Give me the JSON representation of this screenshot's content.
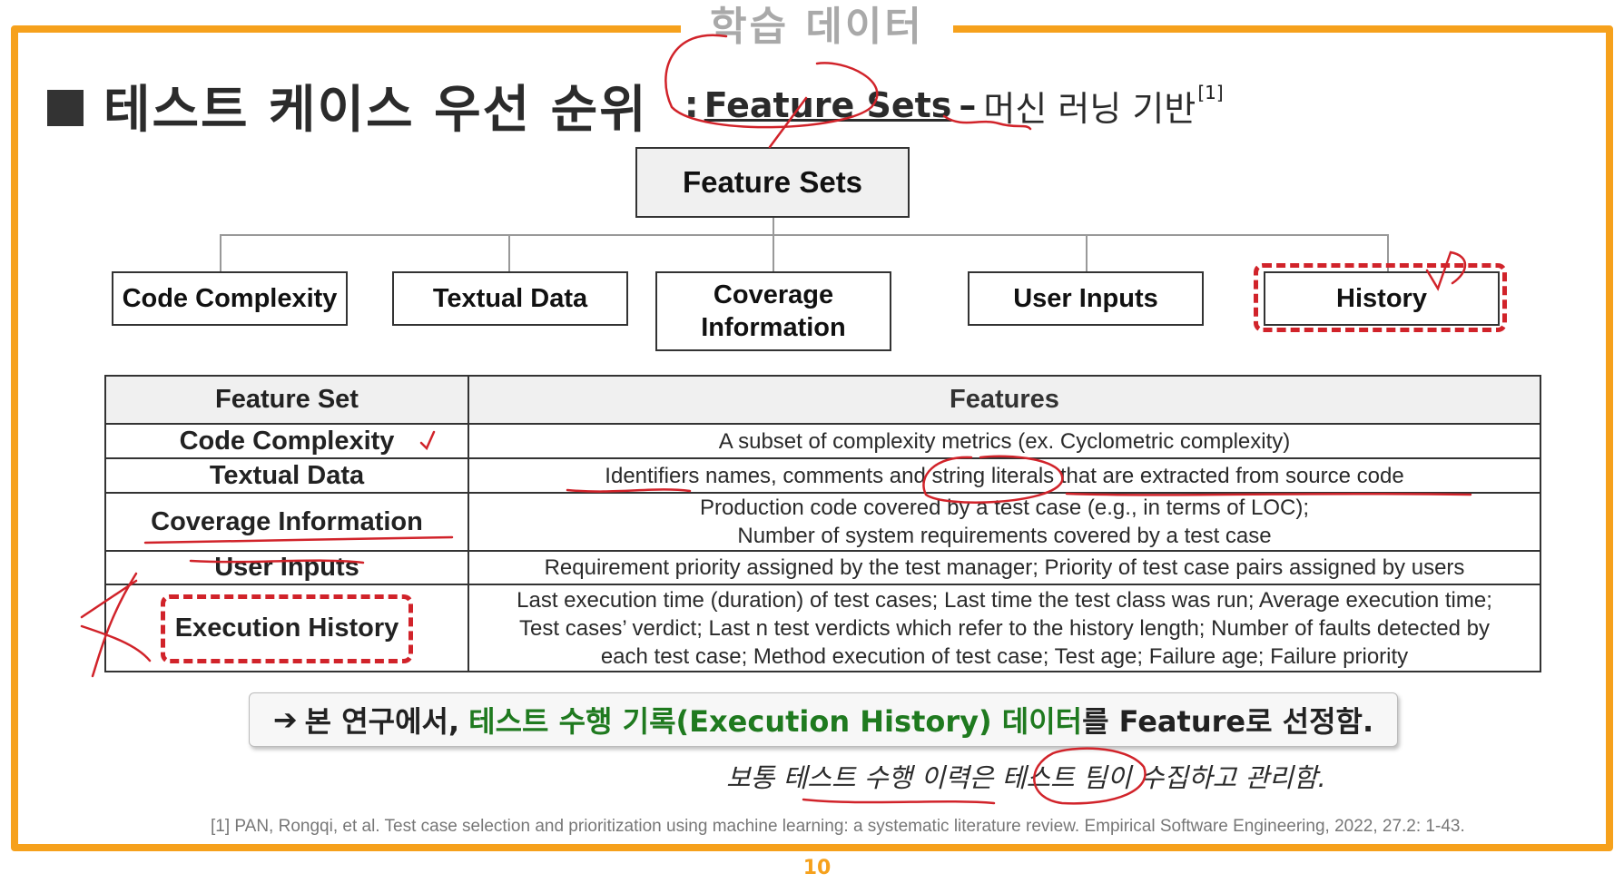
{
  "slide": {
    "section_title": "학습 데이터",
    "page_number": "10",
    "accent_color": "#f6a11c",
    "highlight_color": "#d1232a",
    "emphasis_color": "#1f7a1f"
  },
  "heading": {
    "bullet_icon": "black-square",
    "main": "테스트 케이스 우선 순위",
    "colon": ":",
    "feature_sets": "Feature Sets",
    "dash": "–",
    "method": "머신 러닝 기반",
    "ref": "[1]"
  },
  "diagram": {
    "root": "Feature Sets",
    "children": {
      "code_complexity": "Code Complexity",
      "textual_data": "Textual Data",
      "coverage_line1": "Coverage",
      "coverage_line2": "Information",
      "user_inputs": "User Inputs",
      "history": "History"
    }
  },
  "table": {
    "headers": {
      "feature_set": "Feature Set",
      "features": "Features"
    },
    "rows": [
      {
        "set": "Code Complexity",
        "lines": [
          "A subset of complexity metrics (ex. Cyclometric complexity)"
        ]
      },
      {
        "set": "Textual Data",
        "lines": [
          "Identifiers names, comments and string literals that are extracted from source code"
        ]
      },
      {
        "set": "Coverage Information",
        "lines": [
          "Production code covered by a test case (e.g., in terms of LOC);",
          "Number of system requirements covered by a test case"
        ]
      },
      {
        "set": "User Inputs",
        "lines": [
          "Requirement priority assigned by the test manager; Priority of test case pairs assigned by users"
        ]
      },
      {
        "set": "Execution History",
        "lines": [
          "Last execution time (duration) of test cases; Last time the test class was run; Average execution time;",
          "Test cases’ verdict; Last n test verdicts which refer to the history length; Number of faults detected by",
          "each test case; Method execution of test case; Test age; Failure age; Failure priority"
        ]
      }
    ]
  },
  "conclusion": {
    "arrow": "➔",
    "prefix": "본 연구에서,",
    "highlight": "테스트 수행 기록(Execution History) 데이터",
    "suffix": "를 Feature로 선정함."
  },
  "note": "보통 테스트 수행 이력은 테스트 팀이 수집하고 관리함.",
  "citation": "[1] PAN, Rongqi, et al. Test case selection and prioritization using machine learning: a systematic literature review. Empirical Software Engineering, 2022, 27.2: 1-43."
}
